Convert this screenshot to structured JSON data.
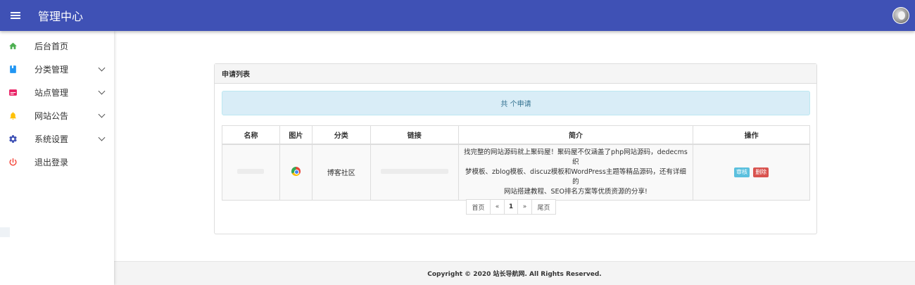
{
  "header": {
    "title": "管理中心",
    "bg_color": "#3f51b5"
  },
  "sidebar": {
    "items": [
      {
        "label": "后台首页",
        "icon": "home-icon",
        "color": "#4caf50"
      },
      {
        "label": "分类管理",
        "icon": "book-icon",
        "color": "#2196f3"
      },
      {
        "label": "站点管理",
        "icon": "browser-window-icon",
        "color": "#e91e63"
      },
      {
        "label": "网站公告",
        "icon": "bell-icon",
        "color": "#ffc107"
      },
      {
        "label": "系统设置",
        "icon": "gear-icon",
        "color": "#3f51b5"
      },
      {
        "label": "退出登录",
        "icon": "power-icon",
        "color": "#f44336"
      }
    ]
  },
  "panel": {
    "heading": "申请列表",
    "alert_text": "共 个申请",
    "alert_bg": "#d9edf7"
  },
  "table": {
    "headers": [
      "名称",
      "图片",
      "分类",
      "链接",
      "简介",
      "操作"
    ],
    "rows": [
      {
        "category": "博客社区",
        "intro_lines": [
          "找完整的网站源码就上聚码屋！聚码屋不仅涵盖了php网站源码，dedecms织",
          "梦模板、zblog模板、discuz模板和WordPress主题等精品源码，还有详细的",
          "网站搭建教程、SEO排名方案等优质资源的分享!"
        ],
        "approve_label": "审核",
        "delete_label": "删除"
      }
    ]
  },
  "pagination": {
    "first": "首页",
    "prev": "«",
    "current": "1",
    "next": "»",
    "last": "尾页"
  },
  "footer": {
    "text": "Copyright © 2020 站长导航网. All Rights Reserved."
  }
}
